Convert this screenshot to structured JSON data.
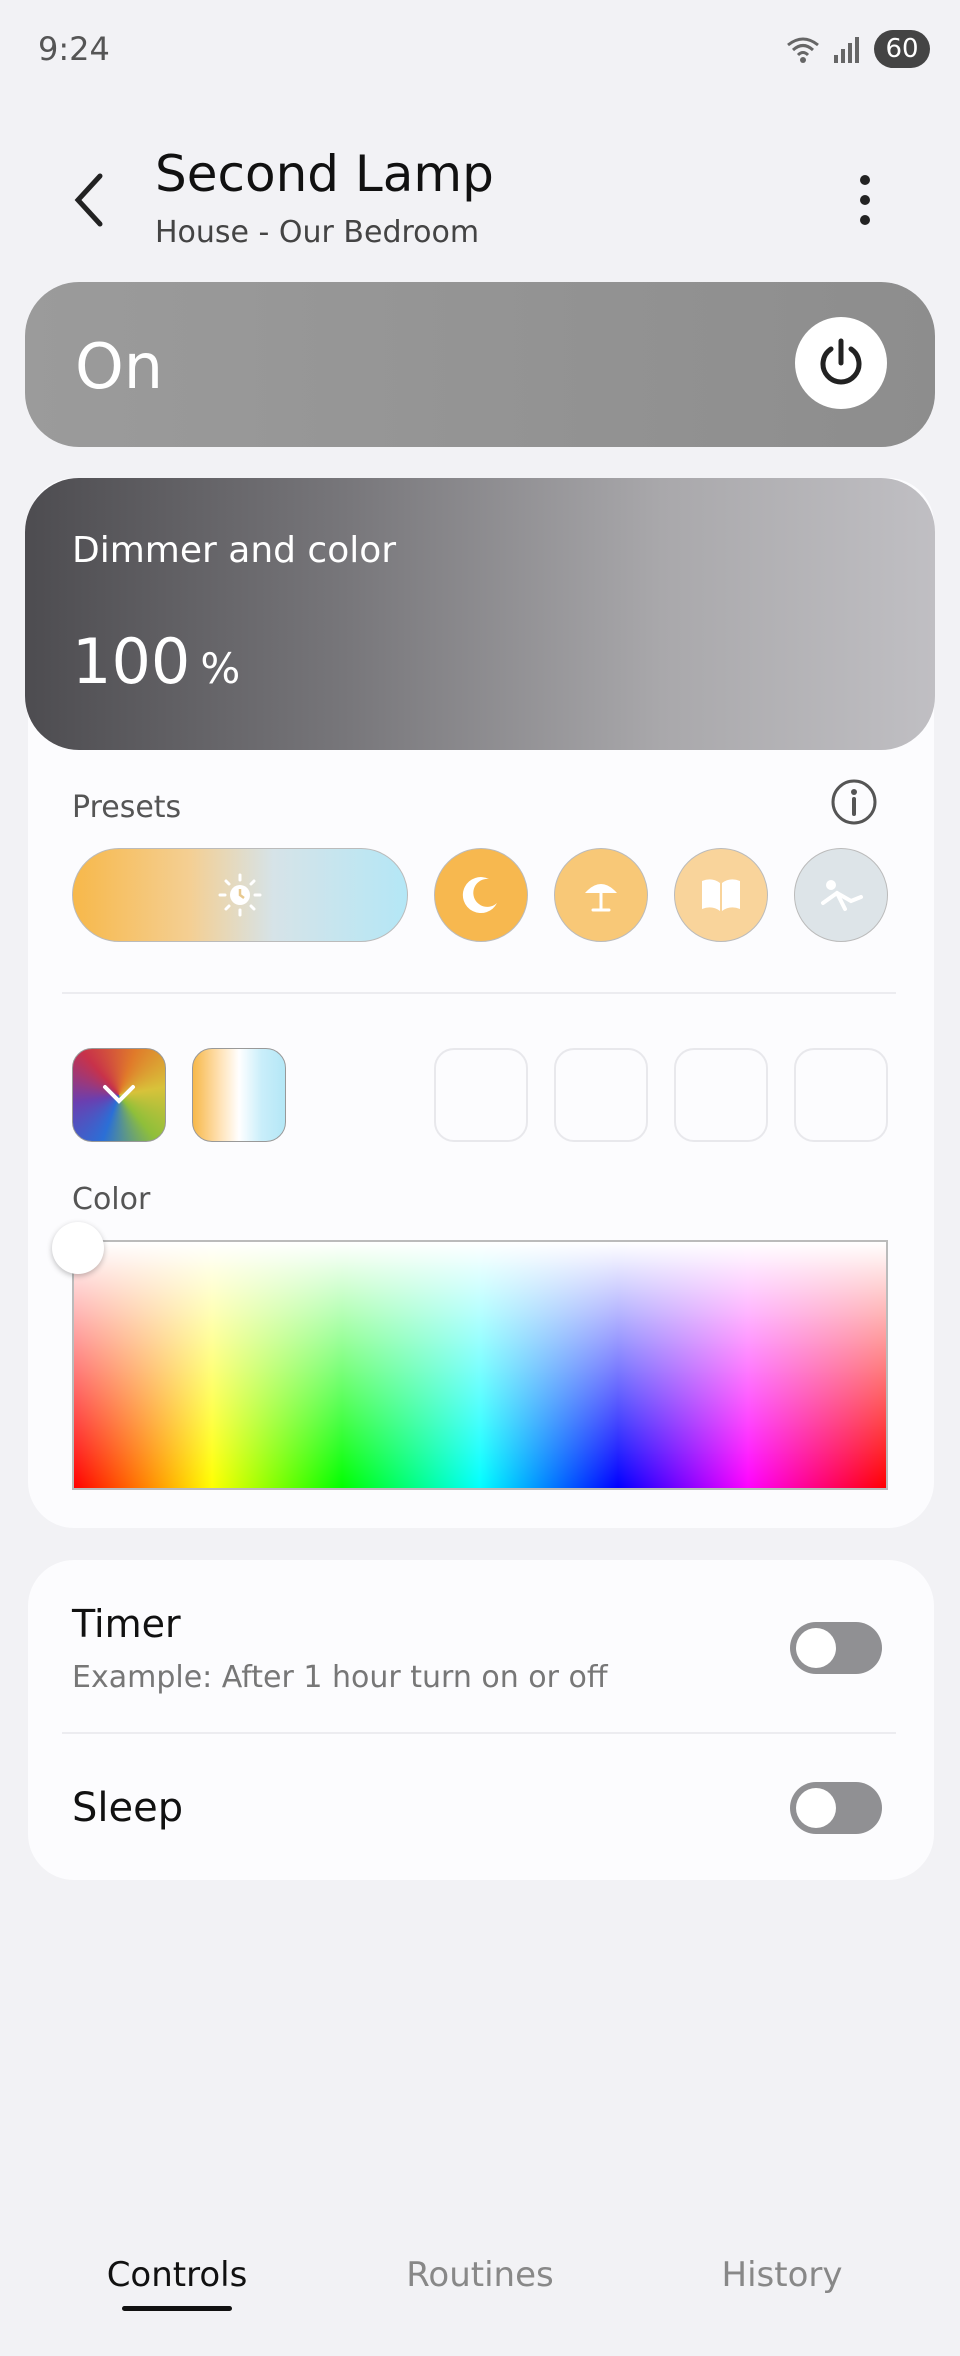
{
  "status": {
    "time": "9:24",
    "battery": "60"
  },
  "header": {
    "title": "Second Lamp",
    "subtitle": "House - Our Bedroom"
  },
  "power": {
    "state_label": "On"
  },
  "dimmer": {
    "label": "Dimmer and color",
    "value": "100",
    "unit": "%"
  },
  "presets": {
    "label": "Presets"
  },
  "color": {
    "label": "Color"
  },
  "timer": {
    "title": "Timer",
    "subtitle": "Example: After 1 hour turn on or off",
    "enabled": false
  },
  "sleep": {
    "title": "Sleep",
    "enabled": false
  },
  "nav": {
    "items": [
      "Controls",
      "Routines",
      "History"
    ],
    "active": "Controls"
  },
  "colors": {
    "accent_orange": "#f7b84a",
    "toggle_off": "#909093"
  }
}
